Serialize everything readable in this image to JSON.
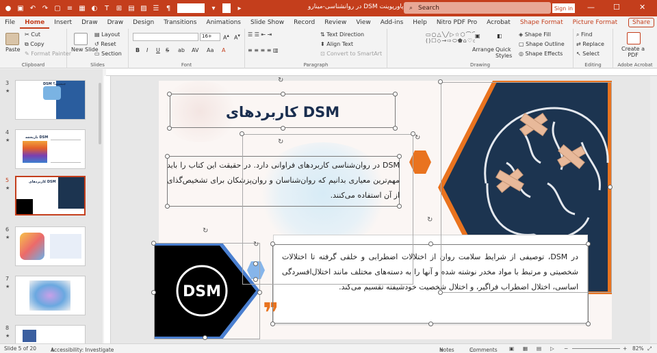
{
  "titlebar": {
    "title": "در روانشناسی-مینارو DSM پاورپوینت  -  PowerPoint",
    "search_placeholder": "Search",
    "signin_label": "Sign in",
    "minimize": "—",
    "maximize": "☐",
    "close": "✕"
  },
  "tabs": [
    "File",
    "Home",
    "Insert",
    "Draw",
    "Draw",
    "Design",
    "Transitions",
    "Animations",
    "Slide Show",
    "Record",
    "Review",
    "View",
    "Add-ins",
    "Help",
    "Nitro PDF Pro",
    "Acrobat"
  ],
  "context_tabs": [
    "Shape Format",
    "Picture Format"
  ],
  "share_label": "Share",
  "ribbon": {
    "clipboard": {
      "paste": "Paste",
      "cut": "Cut",
      "copy": "Copy",
      "format_painter": "Format Painter",
      "label": "Clipboard"
    },
    "slides": {
      "new_slide": "New Slide",
      "layout": "Layout",
      "reset": "Reset",
      "section": "Section",
      "label": "Slides"
    },
    "font": {
      "size": "16+",
      "bold": "B",
      "italic": "I",
      "underline": "U",
      "strike": "S",
      "label": "Font"
    },
    "paragraph": {
      "text_direction": "Text Direction",
      "align_text": "Align Text",
      "smartart": "Convert to SmartArt",
      "label": "Paragraph"
    },
    "drawing": {
      "arrange": "Arrange",
      "quick_styles": "Quick Styles",
      "shape_fill": "Shape Fill",
      "shape_outline": "Shape Outline",
      "shape_effects": "Shape Effects",
      "label": "Drawing"
    },
    "editing": {
      "find": "Find",
      "replace": "Replace",
      "select": "Select",
      "label": "Editing"
    },
    "acrobat": {
      "create_pdf": "Create a PDF",
      "label": "Adobe Acrobat"
    }
  },
  "thumbnails": [
    {
      "num": "3",
      "star": "★",
      "title": "DSM چیست؟"
    },
    {
      "num": "4",
      "star": "★",
      "title": "تاریخچه DSM"
    },
    {
      "num": "5",
      "star": "★",
      "title": "کاربردهای DSM"
    },
    {
      "num": "6",
      "star": "★",
      "title": ""
    },
    {
      "num": "7",
      "star": "★",
      "title": ""
    },
    {
      "num": "8",
      "star": "★",
      "title": ""
    }
  ],
  "slide": {
    "title": "کاربردهای DSM",
    "para1": "DSM در روان‌شناسی کاربردهای فراوانی دارد. در حقیقت این کتاب را باید مهم‌ترین معیاری بدانیم که روان‌شناسان و روان‌پزشکان برای تشخیص‌گذای از آن استفاده می‌کنند.",
    "para2": "در DSM، توصیفی از شرایط سلامت روان از اختلالات اضطرابی و خلقی گرفته تا اختلالات شخصیتی و مرتبط با مواد مخدر نوشته شده و آنها را به دسته‌های مختلف مانند اختلال‌افسردگی اساسی، اختلال اضطراب فراگیر، و اختلال شخصیت خودشیفته تقسیم می‌کند.",
    "logo_text": "DSM",
    "quote_mark": "❞"
  },
  "status": {
    "slide_of": "Slide 5 of 20",
    "accessibility": "Accessibility: Investigate",
    "notes": "Notes",
    "comments": "Comments",
    "zoom": "82%"
  },
  "colors": {
    "accent": "#c43e1c",
    "navy": "#1c3450",
    "orange": "#e9731f",
    "title": "#1a2e4f"
  }
}
